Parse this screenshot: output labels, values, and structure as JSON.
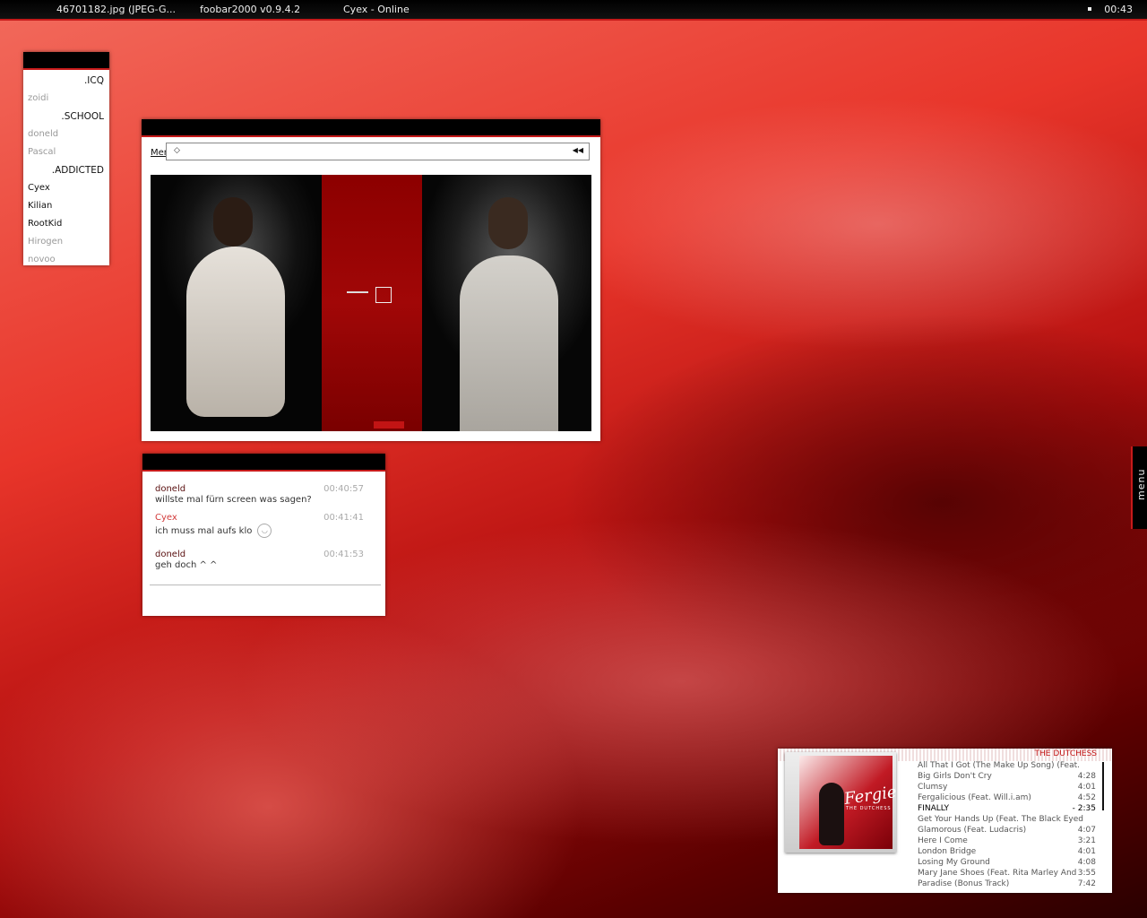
{
  "taskbar": {
    "tasks": [
      "46701182.jpg (JPEG-G...",
      "foobar2000 v0.9.4.2",
      "Cyex - Online"
    ],
    "clock": "00:43"
  },
  "contacts": [
    {
      "label": ".ICQ",
      "type": "group"
    },
    {
      "label": "zoidi",
      "type": "offline"
    },
    {
      "label": ".SCHOOL",
      "type": "group"
    },
    {
      "label": "doneld",
      "type": "offline"
    },
    {
      "label": "Pascal",
      "type": "offline"
    },
    {
      "label": ".ADDICTED",
      "type": "group"
    },
    {
      "label": "Cyex",
      "type": "online"
    },
    {
      "label": "Kilian",
      "type": "online"
    },
    {
      "label": "RootKid",
      "type": "online"
    },
    {
      "label": "Hirogen",
      "type": "offline"
    },
    {
      "label": "novoo",
      "type": "offline"
    }
  ],
  "viewer": {
    "menu_label": "Menu",
    "address_icon": "diamond-icon",
    "rewind_icon": "rewind-icon"
  },
  "chat": {
    "messages": [
      {
        "nick": "doneld",
        "text": "willste mal fürn screen was sagen?",
        "time": "00:40:57",
        "self": false
      },
      {
        "nick": "Cyex",
        "text": "ich muss mal aufs klo",
        "time": "00:41:41",
        "self": true,
        "smiley": true
      },
      {
        "nick": "doneld",
        "text": "geh doch ^ ^",
        "time": "00:41:53",
        "self": false
      }
    ]
  },
  "side_menu": {
    "label": "menu"
  },
  "player": {
    "album": "THE DUTCHESS",
    "cover_artist": "Fergie",
    "cover_subtitle": "THE DUTCHESS",
    "tracks": [
      {
        "title": "All That I Got (The Make Up Song) (Feat.",
        "duration": ""
      },
      {
        "title": "Big Girls Don't Cry",
        "duration": "4:28"
      },
      {
        "title": "Clumsy",
        "duration": "4:01"
      },
      {
        "title": "Fergalicious (Feat. Will.i.am)",
        "duration": "4:52"
      },
      {
        "title": "FINALLY",
        "duration": "- 2:35",
        "playing": true
      },
      {
        "title": "Get Your Hands Up (Feat. The Black Eyed",
        "duration": ""
      },
      {
        "title": "Glamorous (Feat. Ludacris)",
        "duration": "4:07"
      },
      {
        "title": "Here I Come",
        "duration": "3:21"
      },
      {
        "title": "London Bridge",
        "duration": "4:01"
      },
      {
        "title": "Losing My Ground",
        "duration": "4:08"
      },
      {
        "title": "Mary Jane Shoes (Feat. Rita Marley And",
        "duration": "3:55"
      },
      {
        "title": "Paradise (Bonus Track)",
        "duration": "7:42"
      }
    ]
  },
  "colors": {
    "accent": "#c61a1a",
    "titlebar": "#000000"
  }
}
